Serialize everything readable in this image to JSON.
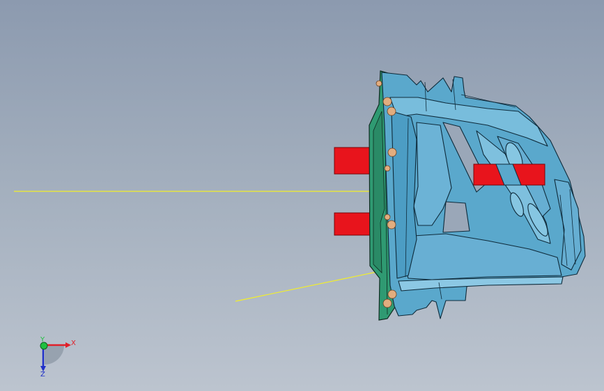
{
  "viewport": {
    "background_top": "#8c9aaf",
    "background_bottom": "#bcc4cf"
  },
  "model": {
    "part_color": "#5aa8cc",
    "part_edge_color": "#0e2a3a",
    "plate_color": "#2f9a72",
    "cylinder_color": "#e8141c",
    "bolt_color": "#e2ad7f",
    "guide_line_color": "#f2ee2a"
  },
  "triad": {
    "x_label": "X",
    "y_label": "Y",
    "z_label": "Z",
    "x_color": "#e0202a",
    "y_color": "#20c040",
    "z_color": "#2030c8"
  }
}
